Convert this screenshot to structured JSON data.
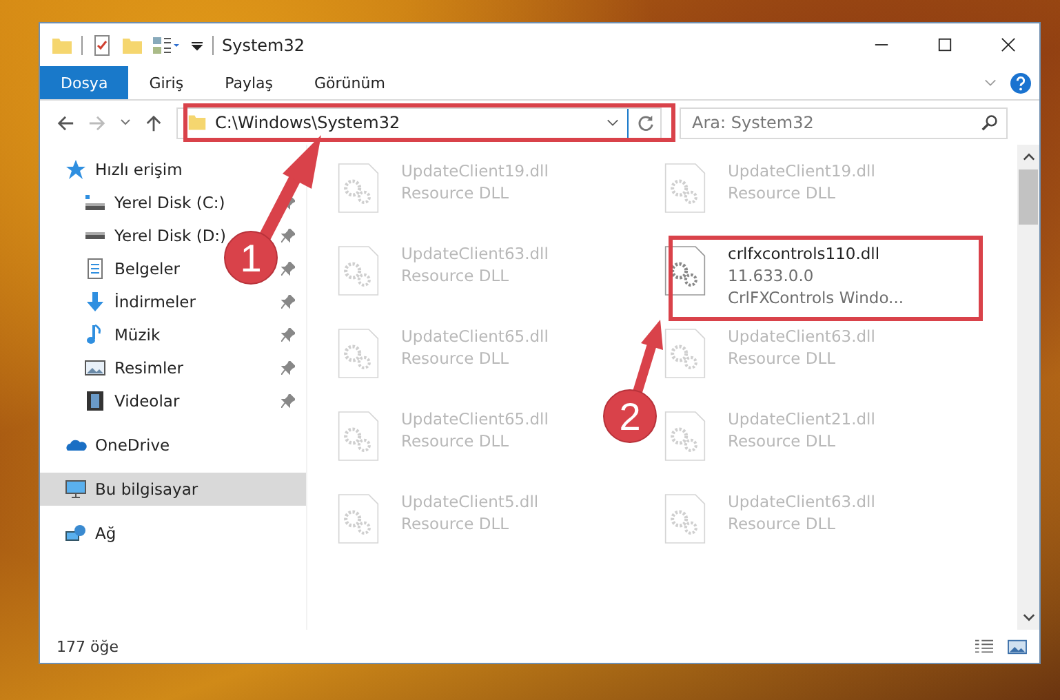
{
  "window": {
    "title": "System32"
  },
  "ribbon_tabs": [
    {
      "label": "Dosya",
      "selected": true
    },
    {
      "label": "Giriş",
      "selected": false
    },
    {
      "label": "Paylaş",
      "selected": false
    },
    {
      "label": "Görünüm",
      "selected": false
    }
  ],
  "address": {
    "path": "C:\\Windows\\System32"
  },
  "search": {
    "placeholder": "Ara: System32"
  },
  "sidebar": {
    "items": [
      {
        "label": "Hızlı erişim",
        "kind": "star",
        "selected": false,
        "children": [
          {
            "label": "Yerel Disk (C:)",
            "kind": "drive-c",
            "selected": false,
            "pinned": true
          },
          {
            "label": "Yerel Disk (D:)",
            "kind": "drive",
            "selected": false,
            "pinned": true
          },
          {
            "label": "Belgeler",
            "kind": "documents",
            "selected": false,
            "pinned": true
          },
          {
            "label": "İndirmeler",
            "kind": "downloads",
            "selected": false,
            "pinned": true
          },
          {
            "label": "Müzik",
            "kind": "music",
            "selected": false,
            "pinned": true
          },
          {
            "label": "Resimler",
            "kind": "pictures",
            "selected": false,
            "pinned": true
          },
          {
            "label": "Videolar",
            "kind": "videos",
            "selected": false,
            "pinned": true
          }
        ]
      },
      {
        "label": "OneDrive",
        "kind": "cloud",
        "selected": false
      },
      {
        "label": "Bu bilgisayar",
        "kind": "computer",
        "selected": true
      },
      {
        "label": "Ağ",
        "kind": "network",
        "selected": false
      }
    ]
  },
  "files": [
    {
      "name": "UpdateClient19.dll",
      "details": [
        "Resource DLL"
      ],
      "blurred": true
    },
    {
      "name": "UpdateClient19.dll",
      "details": [
        "Resource DLL"
      ],
      "blurred": true
    },
    {
      "name": "UpdateClient63.dll",
      "details": [
        "Resource DLL"
      ],
      "blurred": true
    },
    {
      "name": "crlfxcontrols110.dll",
      "details": [
        "11.633.0.0",
        "CrlFXControls Windo..."
      ],
      "blurred": false
    },
    {
      "name": "UpdateClient65.dll",
      "details": [
        "Resource DLL"
      ],
      "blurred": true
    },
    {
      "name": "UpdateClient63.dll",
      "details": [
        "Resource DLL"
      ],
      "blurred": true
    },
    {
      "name": "UpdateClient65.dll",
      "details": [
        "Resource DLL"
      ],
      "blurred": true
    },
    {
      "name": "UpdateClient21.dll",
      "details": [
        "Resource DLL"
      ],
      "blurred": true
    },
    {
      "name": "UpdateClient5.dll",
      "details": [
        "Resource DLL"
      ],
      "blurred": true
    },
    {
      "name": "UpdateClient63.dll",
      "details": [
        "Resource DLL"
      ],
      "blurred": true
    }
  ],
  "status_bar": {
    "count": "177 öğe"
  },
  "annotations": [
    {
      "number": "1"
    },
    {
      "number": "2"
    }
  ]
}
